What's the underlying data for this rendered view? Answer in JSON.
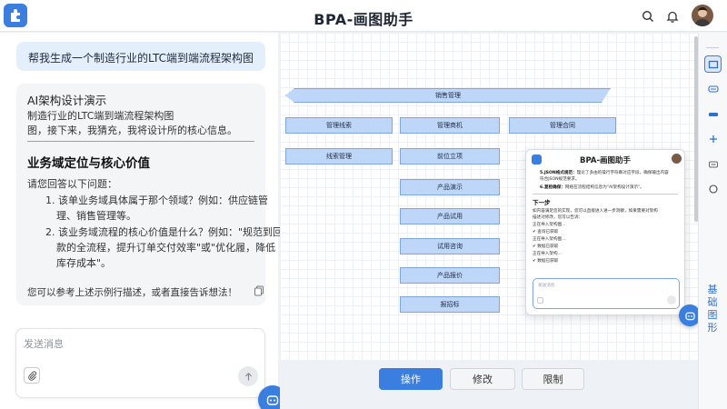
{
  "header": {
    "title": "BPA-画图助手"
  },
  "chat": {
    "user_message": "帮我生成一个制造行业的LTC端到端流程架构图",
    "reply": {
      "title": "AI架构设计演示",
      "line1": "制造行业的LTC端到端流程架构图",
      "line2": "图，接下来，我猜充，我将设计所的核心信息。",
      "heading": "业务域定位与核心价值",
      "prompt": "请您回答以下问题：",
      "q1_line1": "1. 该单业务域具体属于那个领域？例如：供应链管",
      "q1_line2": "理、销售管理等。",
      "q2_line1": "2. 该业务域流程的核心价值是什么？例如：\"规范到回",
      "q2_line2": "款的全流程，提升订单交付效率\"或\"优化履，降低",
      "q2_line3": "库存成本\"。",
      "footer": "您可以参考上述示例行描述，或者直接告诉想法！"
    },
    "input_placeholder": "发送消息"
  },
  "canvas": {
    "banner": "销售管理",
    "row1": [
      "管理线索",
      "管理商机",
      "管理合同"
    ],
    "row2": [
      "线索管理",
      "前位立项"
    ],
    "column": [
      "产品演示",
      "产品试用",
      "试用咨询",
      "产品报价",
      "报招标"
    ]
  },
  "popup": {
    "title": "BPA-画图助手",
    "line1_bold": "5.JSON格式规范：",
    "line1": "理论了多由的操行字符串对应字段，确保输出内容",
    "line2": "符合JSON规范要求。",
    "line3_bold": "6.复检确保：",
    "line3": "网络在流程结构信息为\"AI架构设计演示\"。",
    "heading": "下一步",
    "next1": "如内容满足您的实现，您可以直接进入进一步洞察，如果需要对架构",
    "next2": "描述对修改，您可以告诉：",
    "steps": [
      "正在导入架构图...",
      "✔ 查询已获取",
      "正在导入架构图...",
      "✔ 数据已获取",
      "正在导入架构...",
      "✔ 数据已获取"
    ],
    "input_placeholder": "发送消息"
  },
  "right_toolbar": {
    "basic_shapes": "基础图形"
  },
  "buttons": {
    "operate": "操作",
    "revise": "修改",
    "restrict": "限制"
  },
  "colors": {
    "accent": "#3a7fe0",
    "node_fill": "#bed6f7",
    "node_border": "#7fa6da"
  }
}
